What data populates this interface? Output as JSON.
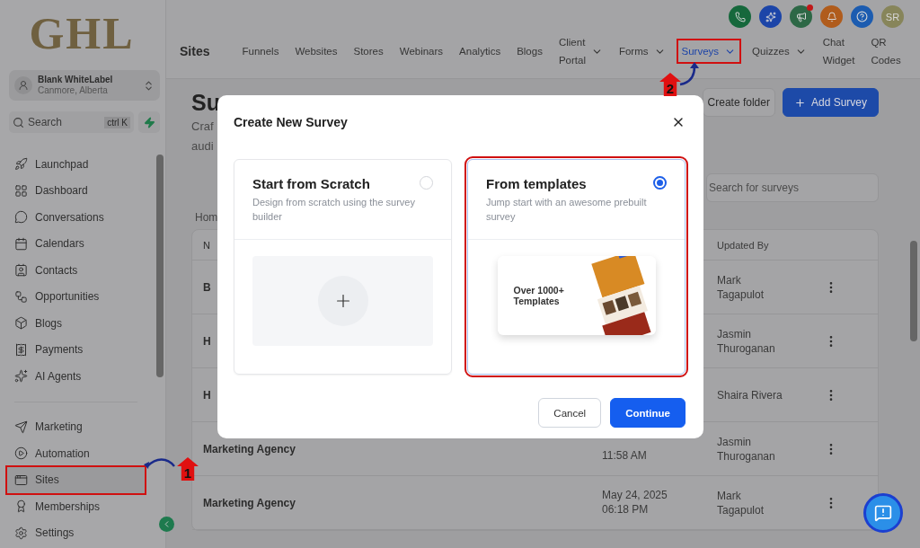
{
  "sidebar": {
    "logo": "GHL",
    "account": {
      "name": "Blank WhiteLabel",
      "location": "Canmore, Alberta"
    },
    "search": {
      "placeholder": "Search",
      "shortcut": "ctrl K"
    },
    "items": [
      {
        "label": "Launchpad",
        "selected": false,
        "highlighted": false
      },
      {
        "label": "Dashboard",
        "selected": false,
        "highlighted": false
      },
      {
        "label": "Conversations",
        "selected": false,
        "highlighted": false
      },
      {
        "label": "Calendars",
        "selected": false,
        "highlighted": false
      },
      {
        "label": "Contacts",
        "selected": false,
        "highlighted": false
      },
      {
        "label": "Opportunities",
        "selected": false,
        "highlighted": false
      },
      {
        "label": "Blogs",
        "selected": false,
        "highlighted": false
      },
      {
        "label": "Payments",
        "selected": false,
        "highlighted": false
      },
      {
        "label": "AI Agents",
        "selected": false,
        "highlighted": false
      }
    ],
    "bottom_items": [
      {
        "label": "Marketing",
        "selected": false,
        "highlighted": false
      },
      {
        "label": "Automation",
        "selected": false,
        "highlighted": false
      },
      {
        "label": "Sites",
        "selected": true,
        "highlighted": true
      },
      {
        "label": "Memberships",
        "selected": false,
        "highlighted": false
      },
      {
        "label": "Settings",
        "selected": false,
        "highlighted": false
      }
    ]
  },
  "header": {
    "section": "Sites",
    "avatar": "SR",
    "tabs": [
      {
        "label": "Funnels",
        "dropdown": false,
        "selected": false,
        "highlighted": false
      },
      {
        "label": "Websites",
        "dropdown": false,
        "selected": false,
        "highlighted": false
      },
      {
        "label": "Stores",
        "dropdown": false,
        "selected": false,
        "highlighted": false
      },
      {
        "label": "Webinars",
        "dropdown": false,
        "selected": false,
        "highlighted": false
      },
      {
        "label": "Analytics",
        "dropdown": false,
        "selected": false,
        "highlighted": false
      },
      {
        "label": "Blogs",
        "dropdown": false,
        "selected": false,
        "highlighted": false
      },
      {
        "label": "Client Portal",
        "dropdown": true,
        "selected": false,
        "highlighted": false
      },
      {
        "label": "Forms",
        "dropdown": true,
        "selected": false,
        "highlighted": false
      },
      {
        "label": "Surveys",
        "dropdown": true,
        "selected": true,
        "highlighted": true
      },
      {
        "label": "Quizzes",
        "dropdown": true,
        "selected": false,
        "highlighted": false
      },
      {
        "label": "Chat Widget",
        "dropdown": false,
        "selected": false,
        "highlighted": false
      },
      {
        "label": "QR Codes",
        "dropdown": false,
        "selected": false,
        "highlighted": false
      }
    ]
  },
  "page": {
    "title": "Su",
    "subtitle": [
      "Craf",
      "audi"
    ],
    "buttons": [
      "Create folder",
      "Add Survey"
    ],
    "search": {
      "placeholder": "Search for surveys"
    },
    "breadcrumb": "Hom",
    "table": {
      "columns": [
        "N",
        "Updated By"
      ],
      "rows": [
        {
          "name": "B",
          "date": "",
          "updated_by": "Mark Tagapulot"
        },
        {
          "name": "H",
          "date": "",
          "updated_by": "Jasmin Thuroganan"
        },
        {
          "name": "H",
          "date": "",
          "updated_by": "Shaira Rivera"
        },
        {
          "name": "Marketing Agency",
          "date": "11:58 AM",
          "updated_by": "Jasmin Thuroganan"
        },
        {
          "name": "Marketing Agency",
          "date": "May 24, 2025 06:18 PM",
          "updated_by": "Mark Tagapulot"
        }
      ]
    }
  },
  "modal": {
    "title": "Create New Survey",
    "buttons": [
      "Cancel",
      "Continue"
    ],
    "options": [
      {
        "kind": "scratch",
        "title": "Start from Scratch",
        "description": "Design from scratch using the survey builder",
        "selected": false,
        "highlighted": false
      },
      {
        "kind": "templates",
        "title": "From templates",
        "description": "Jump start with an awesome prebuilt survey",
        "selected": true,
        "highlighted": true,
        "preview_text": "Over 1000+ Templates"
      }
    ]
  },
  "annotations": [
    {
      "label": "1"
    },
    {
      "label": "2"
    }
  ]
}
